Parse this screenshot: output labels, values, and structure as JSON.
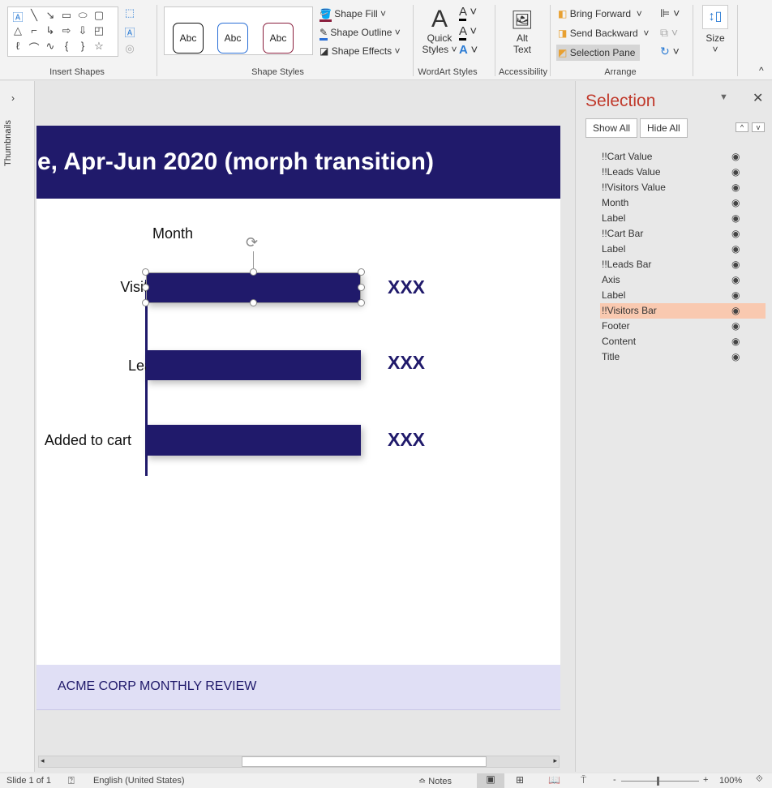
{
  "ribbon": {
    "groups": {
      "insert_shapes": "Insert Shapes",
      "shape_styles": "Shape Styles",
      "wordart_styles": "WordArt Styles",
      "accessibility": "Accessibility",
      "arrange": "Arrange"
    },
    "style_samples": [
      "Abc",
      "Abc",
      "Abc"
    ],
    "shape_fill": "Shape Fill",
    "shape_outline": "Shape Outline",
    "shape_effects": "Shape Effects",
    "quick_styles": "Quick",
    "quick_styles2": "Styles",
    "alt_text": "Alt",
    "alt_text2": "Text",
    "bring_forward": "Bring Forward",
    "send_backward": "Send Backward",
    "selection_pane": "Selection Pane",
    "size": "Size",
    "thumbnails": "Thumbnails"
  },
  "slide": {
    "title": "e, Apr-Jun 2020 (morph transition)",
    "month": "Month",
    "rows": [
      {
        "label": "Visitors",
        "value": "XXX"
      },
      {
        "label": "Leads",
        "value": "XXX"
      },
      {
        "label": "Added to cart",
        "value": "XXX"
      }
    ],
    "footer": "ACME CORP MONTHLY REVIEW"
  },
  "pane": {
    "title": "Selection",
    "show_all": "Show All",
    "hide_all": "Hide All",
    "items": [
      "!!Cart Value",
      "!!Leads Value",
      "!!Visitors Value",
      "Month",
      "Label",
      "!!Cart Bar",
      "Label",
      "!!Leads Bar",
      "Axis",
      "Label",
      "!!Visitors Bar",
      "Footer",
      "Content",
      "Title"
    ],
    "selected": "!!Visitors Bar"
  },
  "status": {
    "slide": "Slide 1 of 1",
    "language": "English (United States)",
    "notes": "Notes",
    "zoom": "100%"
  },
  "colors": {
    "navy": "#201a6b",
    "footer_bg": "#e0dff5",
    "selected_row": "#f9c9b0",
    "pane_title": "#c0392b"
  }
}
